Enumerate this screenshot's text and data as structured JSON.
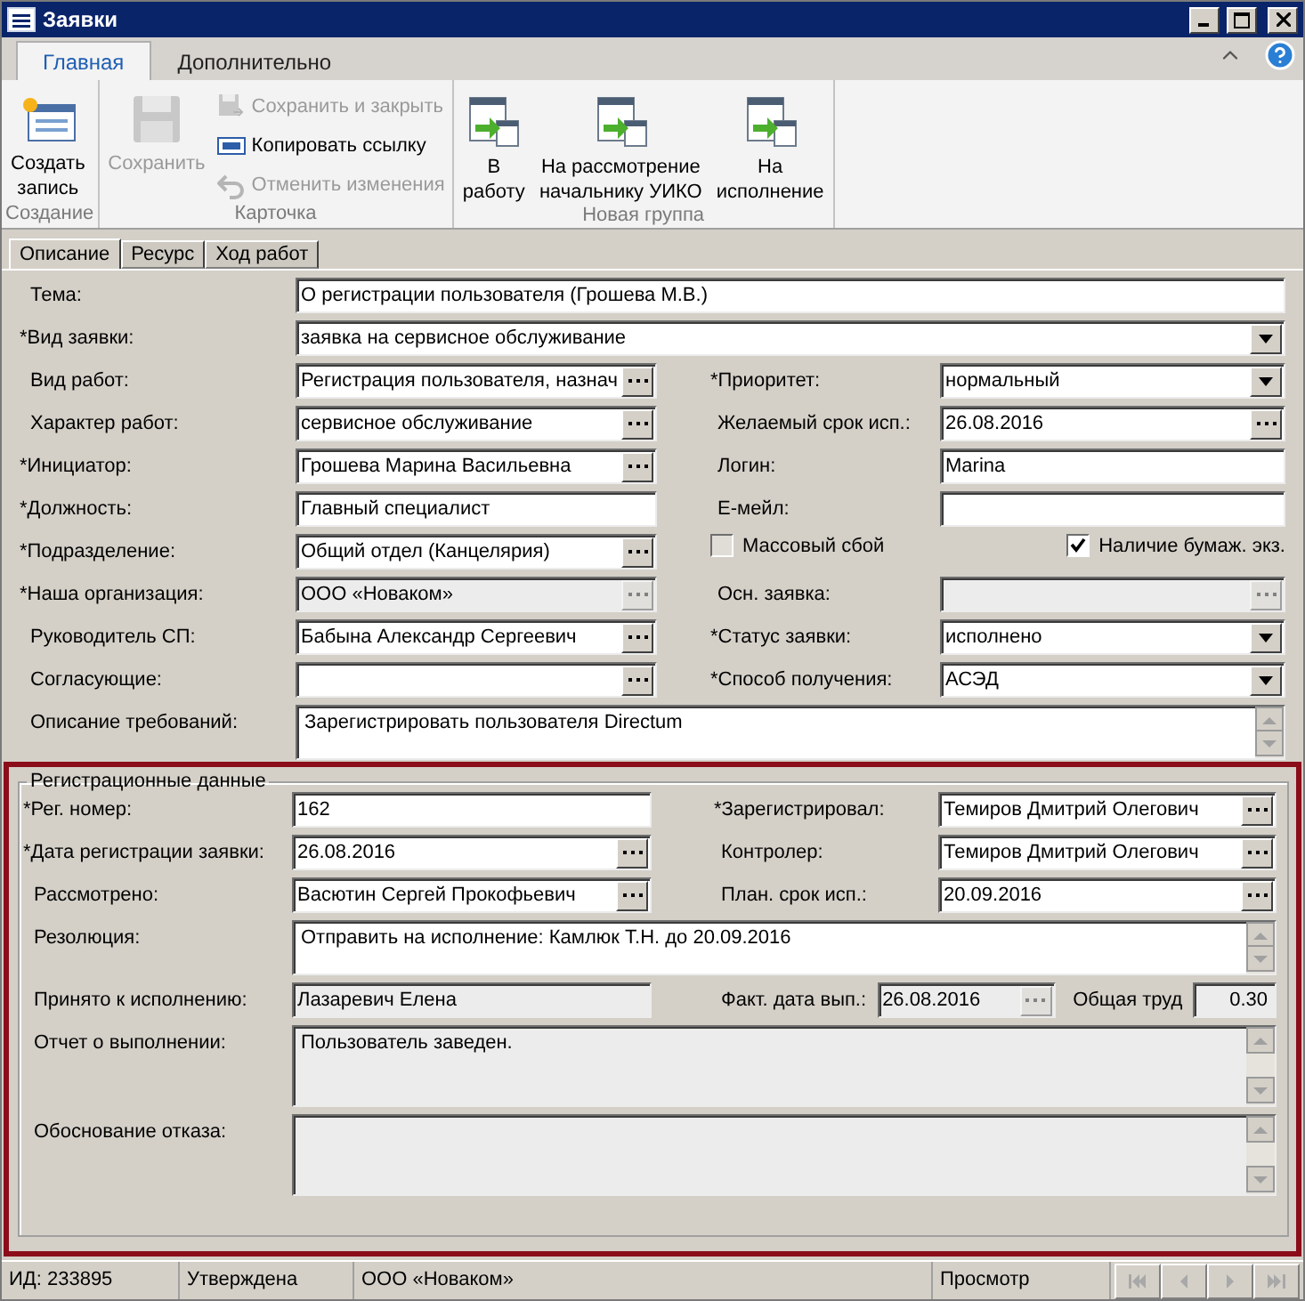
{
  "window": {
    "title": "Заявки"
  },
  "ribbon": {
    "tabs": [
      {
        "label": "Главная",
        "selected": true
      },
      {
        "label": "Дополнительно",
        "selected": false
      }
    ],
    "groups": [
      {
        "caption": "Создание",
        "buttons": [
          {
            "kind": "create",
            "label": "Создать\nзапись",
            "disabled": false
          }
        ]
      },
      {
        "caption": "Карточка",
        "buttons": [
          {
            "kind": "save",
            "label": "Сохранить",
            "disabled": true
          },
          {
            "kind": "saveclose",
            "label": "Сохранить и закрыть",
            "disabled": true
          },
          {
            "kind": "link",
            "label": "Копировать ссылку",
            "disabled": false
          },
          {
            "kind": "undo",
            "label": "Отменить изменения",
            "disabled": true
          }
        ]
      },
      {
        "caption": "Новая группа",
        "buttons": [
          {
            "kind": "route",
            "label": "В\nработу",
            "disabled": false
          },
          {
            "kind": "route",
            "label": "На рассмотрение\nначальнику УИКО",
            "disabled": false
          },
          {
            "kind": "route",
            "label": "На\nисполнение",
            "disabled": false
          }
        ]
      }
    ]
  },
  "doc_tabs": [
    {
      "label": "Описание",
      "selected": true
    },
    {
      "label": "Ресурс",
      "selected": false
    },
    {
      "label": "Ход работ",
      "selected": false
    }
  ],
  "form": {
    "rows": [
      {
        "left": {
          "label": "Тема:",
          "required": false,
          "kind": "text",
          "value": "О регистрации пользователя (Грошева М.В.)"
        }
      },
      {
        "left": {
          "label": "*Вид заявки:",
          "required": true,
          "kind": "select",
          "value": "заявка на сервисное обслуживание"
        }
      },
      {
        "left": {
          "label": "Вид работ:",
          "required": false,
          "kind": "lookup",
          "value": "Регистрация пользователя, назнач"
        },
        "right": [
          {
            "label": "*Приоритет:",
            "required": true,
            "kind": "select",
            "value": "нормальный"
          }
        ]
      },
      {
        "left": {
          "label": "Характер работ:",
          "required": false,
          "kind": "lookup",
          "value": "сервисное обслуживание"
        },
        "right": [
          {
            "label": "Желаемый срок исп.:",
            "required": false,
            "kind": "lookup",
            "value": "26.08.2016"
          }
        ]
      },
      {
        "left": {
          "label": "*Инициатор:",
          "required": true,
          "kind": "lookup",
          "value": "Грошева Марина Васильевна"
        },
        "right": [
          {
            "label": "Логин:",
            "required": false,
            "kind": "text",
            "value": "Marina"
          }
        ]
      },
      {
        "left": {
          "label": "*Должность:",
          "required": true,
          "kind": "text",
          "value": "Главный специалист"
        },
        "right": [
          {
            "label": "Е-мейл:",
            "required": false,
            "kind": "text"
          }
        ]
      },
      {
        "left": {
          "label": "*Подразделение:",
          "required": true,
          "kind": "lookup",
          "value": "Общий отдел (Канцелярия)"
        },
        "right": [
          {
            "kind": "checkbox",
            "label": "Массовый сбой",
            "checked": false,
            "disabled": true
          },
          {
            "kind": "checkbox",
            "label": "Наличие бумаж. экз.",
            "checked": true,
            "disabled": false
          }
        ]
      },
      {
        "left": {
          "label": "*Наша организация:",
          "required": true,
          "kind": "lookup",
          "value": "ООО «Новаком»",
          "disabled": true
        },
        "right": [
          {
            "label": "Осн. заявка:",
            "required": false,
            "kind": "lookup",
            "disabled": true
          }
        ]
      },
      {
        "left": {
          "label": "Руководитель СП:",
          "required": false,
          "kind": "lookup",
          "value": "Бабына Александр Сергеевич"
        },
        "right": [
          {
            "label": "*Статус заявки:",
            "required": true,
            "kind": "select",
            "value": "исполнено"
          }
        ]
      },
      {
        "left": {
          "label": "Согласующие:",
          "required": false,
          "kind": "lookup"
        },
        "right": [
          {
            "label": "*Способ получения:",
            "required": true,
            "kind": "select",
            "value": "АСЭД"
          }
        ]
      },
      {
        "left": {
          "label": "Описание требований:",
          "required": false,
          "kind": "memo",
          "value": "Зарегистрировать пользователя Directum"
        }
      }
    ]
  },
  "registration": {
    "title": "Регистрационные данные",
    "rows": [
      {
        "left": {
          "label": "*Рег. номер:",
          "required": true,
          "kind": "text",
          "value": "162"
        },
        "right": [
          {
            "label": "*Зарегистрировал:",
            "required": true,
            "kind": "lookup",
            "value": "Темиров Дмитрий Олегович"
          }
        ]
      },
      {
        "left": {
          "label": "*Дата регистрации заявки:",
          "required": true,
          "kind": "lookup",
          "value": "26.08.2016"
        },
        "right": [
          {
            "label": "Контролер:",
            "required": false,
            "kind": "lookup",
            "value": "Темиров Дмитрий Олегович"
          }
        ]
      },
      {
        "left": {
          "label": "Рассмотрено:",
          "required": false,
          "kind": "lookup",
          "value": "Васютин Сергей Прокофьевич"
        },
        "right": [
          {
            "label": "План. срок исп.:",
            "required": false,
            "kind": "lookup",
            "value": "20.09.2016"
          }
        ]
      },
      {
        "left": {
          "label": "Резолюция:",
          "required": false,
          "kind": "memo",
          "value": "Отправить на исполнение: Камлюк Т.Н. до 20.09.2016"
        }
      },
      {
        "left": {
          "label": "Принято к исполнению:",
          "required": false,
          "kind": "text",
          "value": "Лазаревич Елена",
          "disabled": true
        },
        "right": [
          {
            "label": "Факт. дата вып.:",
            "required": false,
            "kind": "lookup",
            "value": "26.08.2016",
            "disabled": true
          },
          {
            "label": "Общая труд",
            "required": false,
            "kind": "number",
            "value": "0.30",
            "disabled": true
          }
        ]
      },
      {
        "left": {
          "label": "Отчет о выполнении:",
          "required": false,
          "kind": "memotall",
          "value": "Пользователь заведен.",
          "disabled": true
        }
      },
      {
        "left": {
          "label": "Обоснование отказа:",
          "required": false,
          "kind": "memotall",
          "disabled": true
        }
      }
    ]
  },
  "status_bar": {
    "cells": [
      "ИД: 233895",
      "Утверждена",
      "ООО «Новаком»",
      "Просмотр"
    ],
    "nav_buttons": [
      {
        "kind": "first",
        "disabled": true
      },
      {
        "kind": "prev",
        "disabled": true
      },
      {
        "kind": "next",
        "disabled": true
      },
      {
        "kind": "last",
        "disabled": true
      }
    ]
  }
}
